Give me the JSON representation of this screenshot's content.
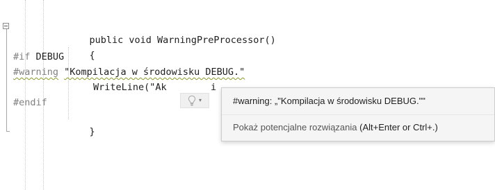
{
  "code": {
    "line_method": "public void WarningPreProcessor()",
    "line_open": "{",
    "line_if": "#if",
    "line_if_symbol": " DEBUG",
    "line_warning_directive": "#warning",
    "line_warning_message": "\"Kompilacja w środowisku DEBUG.\"",
    "line_writeline_visible": "WriteLine(\"Ak",
    "line_writeline_tail": "i",
    "line_endif": "#endif",
    "line_close": "}"
  },
  "lightbulb": {
    "icon": "lightbulb-icon",
    "dropdown_icon": "chevron-down-icon",
    "caret": "▾"
  },
  "tooltip": {
    "message": "#warning: „\"Kompilacja w środowisku DEBUG.\"\"",
    "fix_link": "Pokaż potencjalne rozwiązania",
    "fix_keys": " (Alt+Enter or Ctrl+.)"
  },
  "colors": {
    "preprocessor": "#808080",
    "code_text": "#1e1e1e",
    "squiggle": "#8a9a2a",
    "tooltip_bg": "#f5f5f5"
  }
}
